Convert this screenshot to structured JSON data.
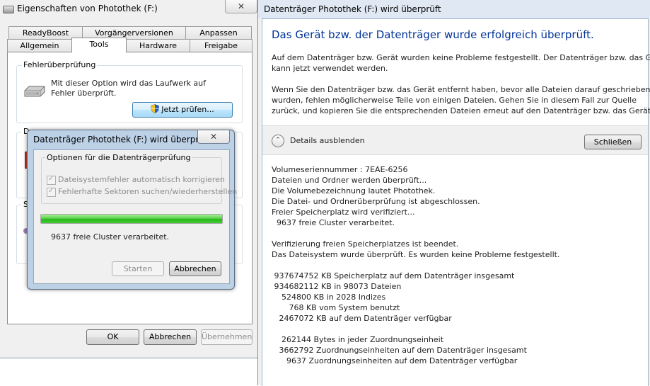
{
  "props_window": {
    "title": "Eigenschaften von Photothek (F:)",
    "close_glyph": "✕",
    "tabs_row_top": [
      "ReadyBoost",
      "Vorgängerversionen",
      "Anpassen"
    ],
    "tabs_row_bottom": [
      "Allgemein",
      "Tools",
      "Hardware",
      "Freigabe"
    ],
    "active_tab": "Tools",
    "error_check": {
      "group_label": "Fehlerüberprüfung",
      "description_line1": "Mit dieser Option wird das Laufwerk auf",
      "description_line2": "Fehler überprüft.",
      "check_now_button": "Jetzt prüfen..."
    },
    "occluded_label_1": "D",
    "occluded_label_2": "S",
    "buttons": {
      "ok": "OK",
      "cancel": "Abbrechen",
      "apply": "Übernehmen"
    }
  },
  "progress_dialog": {
    "title": "Datenträger Photothek (F:) wird überprüft",
    "close_glyph": "✕",
    "options_label": "Optionen für die Datenträgerprüfung",
    "option_fix": "Dateisystemfehler automatisch korrigieren",
    "option_scan": "Fehlerhafte Sektoren suchen/wiederherstellen",
    "progress_fraction": 1.0,
    "status": "9637 freie Cluster verarbeitet.",
    "start_button": "Starten",
    "cancel_button": "Abbrechen"
  },
  "result_window": {
    "title": "Datenträger Photothek (F:) wird überprüft",
    "headline": "Das Gerät bzw. der Datenträger wurde erfolgreich überprüft.",
    "para1_line1": "Auf dem Datenträger bzw. Gerät wurden keine Probleme festgestellt. Der Datenträger bzw. das Gerät",
    "para1_line2": "kann jetzt verwendet werden.",
    "para2_line1": "Wenn Sie den Datenträger bzw. das Gerät entfernt haben, bevor alle Dateien darauf geschrieben",
    "para2_line2": "wurden, fehlen möglicherweise Teile von einigen Dateien. Gehen Sie in diesem Fall zur Quelle",
    "para2_line3": "zurück, und kopieren Sie die entsprechenden Dateien erneut auf den Datenträger bzw. das Gerät.",
    "details_toggle": "Details ausblenden",
    "toggle_glyph": "⌃",
    "close_button": "Schließen",
    "log": [
      "Volumeseriennummer : 7EAE-6256",
      "Dateien und Ordner werden überprüft...",
      "Die Volumebezeichnung lautet Photothek.",
      "Die Datei- und Ordnerüberprüfung ist abgeschlossen.",
      "Freier Speicherplatz wird verifiziert...",
      "  9637 freie Cluster verarbeitet.",
      "",
      "Verifizierung freien Speicherplatzes ist beendet.",
      "Das Dateisystem wurde überprüft. Es wurden keine Probleme festgestellt.",
      "",
      " 937674752 KB Speicherplatz auf dem Datenträger insgesamt",
      " 934682112 KB in 98073 Dateien",
      "    524800 KB in 2028 Indizes",
      "       768 KB vom System benutzt",
      "   2467072 KB auf dem Datenträger verfügbar",
      "",
      "    262144 Bytes in jeder Zuordnungseinheit",
      "   3662792 Zuordnungseinheiten auf dem Datenträger insgesamt",
      "      9637 Zuordnungseinheiten auf dem Datenträger verfügbar"
    ]
  }
}
